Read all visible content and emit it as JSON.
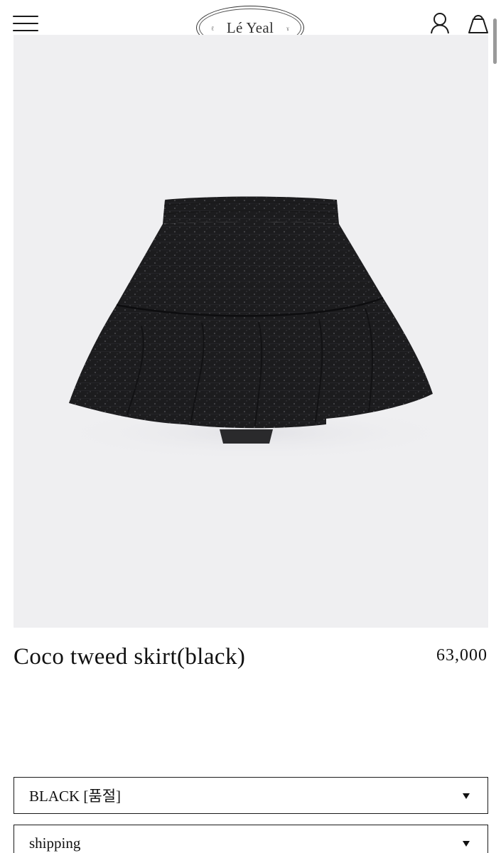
{
  "header": {
    "logo_text": "Lé Yeal",
    "menu_icon": "hamburger-menu-icon",
    "account_icon": "user-icon",
    "cart_icon": "shopping-bag-icon"
  },
  "product": {
    "image_alt": "Coco tweed skirt(black)",
    "title": "Coco tweed skirt(black)",
    "price": "63,000"
  },
  "options": {
    "color_selected": "BLACK [품절]",
    "shipping_selected": "shipping"
  },
  "colors": {
    "background": "#ffffff",
    "image_background": "#efeff1",
    "text": "#1a1a1a",
    "skirt": "#1c1c1e"
  }
}
